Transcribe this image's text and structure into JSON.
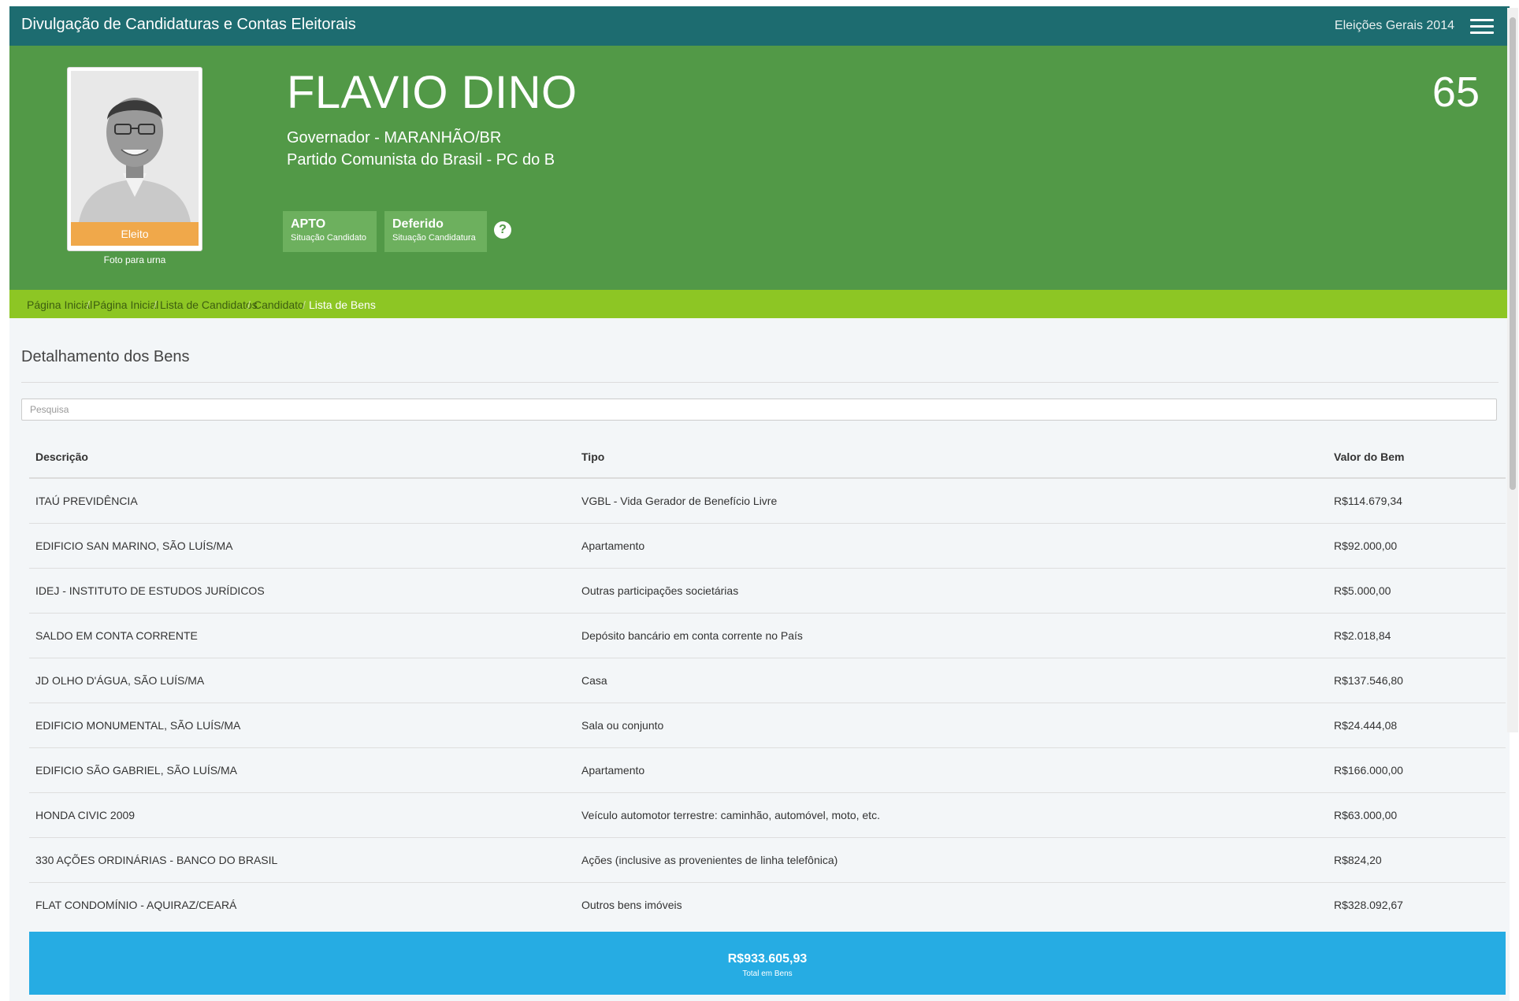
{
  "topbar": {
    "title": "Divulgação de Candidaturas e Contas Eleitorais",
    "election": "Eleições Gerais 2014",
    "menu_icon": "hamburger-icon"
  },
  "candidate": {
    "name": "FLAVIO DINO",
    "office": "Governador - MARANHÃO/BR",
    "party": "Partido Comunista do Brasil - PC do B",
    "number": "65",
    "elected_label": "Eleito",
    "photo_caption": "Foto para urna",
    "status_candidate": {
      "value": "APTO",
      "label": "Situação Candidato"
    },
    "status_candidacy": {
      "value": "Deferido",
      "label": "Situação Candidatura"
    },
    "help_icon": "question-circle-icon"
  },
  "breadcrumb": {
    "items": [
      "Página Inicial",
      "Página Inicial",
      "Lista de Candidatos",
      "Candidato",
      "Lista de Bens"
    ],
    "separator": "/"
  },
  "assets": {
    "title": "Detalhamento dos Bens",
    "search_placeholder": "Pesquisa",
    "columns": [
      "Descrição",
      "Tipo",
      "Valor do Bem"
    ],
    "rows": [
      {
        "desc": "ITAÚ PREVIDÊNCIA",
        "type": "VGBL - Vida Gerador de Benefício Livre",
        "value": "R$114.679,34"
      },
      {
        "desc": "EDIFICIO SAN MARINO, SÃO LUÍS/MA",
        "type": "Apartamento",
        "value": "R$92.000,00"
      },
      {
        "desc": "IDEJ - INSTITUTO DE ESTUDOS JURÍDICOS",
        "type": "Outras participações societárias",
        "value": "R$5.000,00"
      },
      {
        "desc": "SALDO EM CONTA CORRENTE",
        "type": "Depósito bancário em conta corrente no País",
        "value": "R$2.018,84"
      },
      {
        "desc": "JD OLHO D'ÁGUA, SÃO LUÍS/MA",
        "type": "Casa",
        "value": "R$137.546,80"
      },
      {
        "desc": "EDIFICIO MONUMENTAL, SÃO LUÍS/MA",
        "type": "Sala ou conjunto",
        "value": "R$24.444,08"
      },
      {
        "desc": "EDIFICIO SÃO GABRIEL, SÃO LUÍS/MA",
        "type": "Apartamento",
        "value": "R$166.000,00"
      },
      {
        "desc": "HONDA CIVIC 2009",
        "type": "Veículo automotor terrestre: caminhão, automóvel, moto, etc.",
        "value": "R$63.000,00"
      },
      {
        "desc": "330 AÇÕES ORDINÁRIAS - BANCO DO BRASIL",
        "type": "Ações (inclusive as provenientes de linha telefônica)",
        "value": "R$824,20"
      },
      {
        "desc": "FLAT CONDOMÍNIO - AQUIRAZ/CEARÁ",
        "type": "Outros bens imóveis",
        "value": "R$328.092,67"
      }
    ],
    "total_value": "R$933.605,93",
    "total_label": "Total em Bens"
  },
  "colors": {
    "topbar": "#1d6c70",
    "hero": "#529947",
    "breadcrumb": "#8dc624",
    "elected": "#f0a84a",
    "total": "#26ace3"
  }
}
